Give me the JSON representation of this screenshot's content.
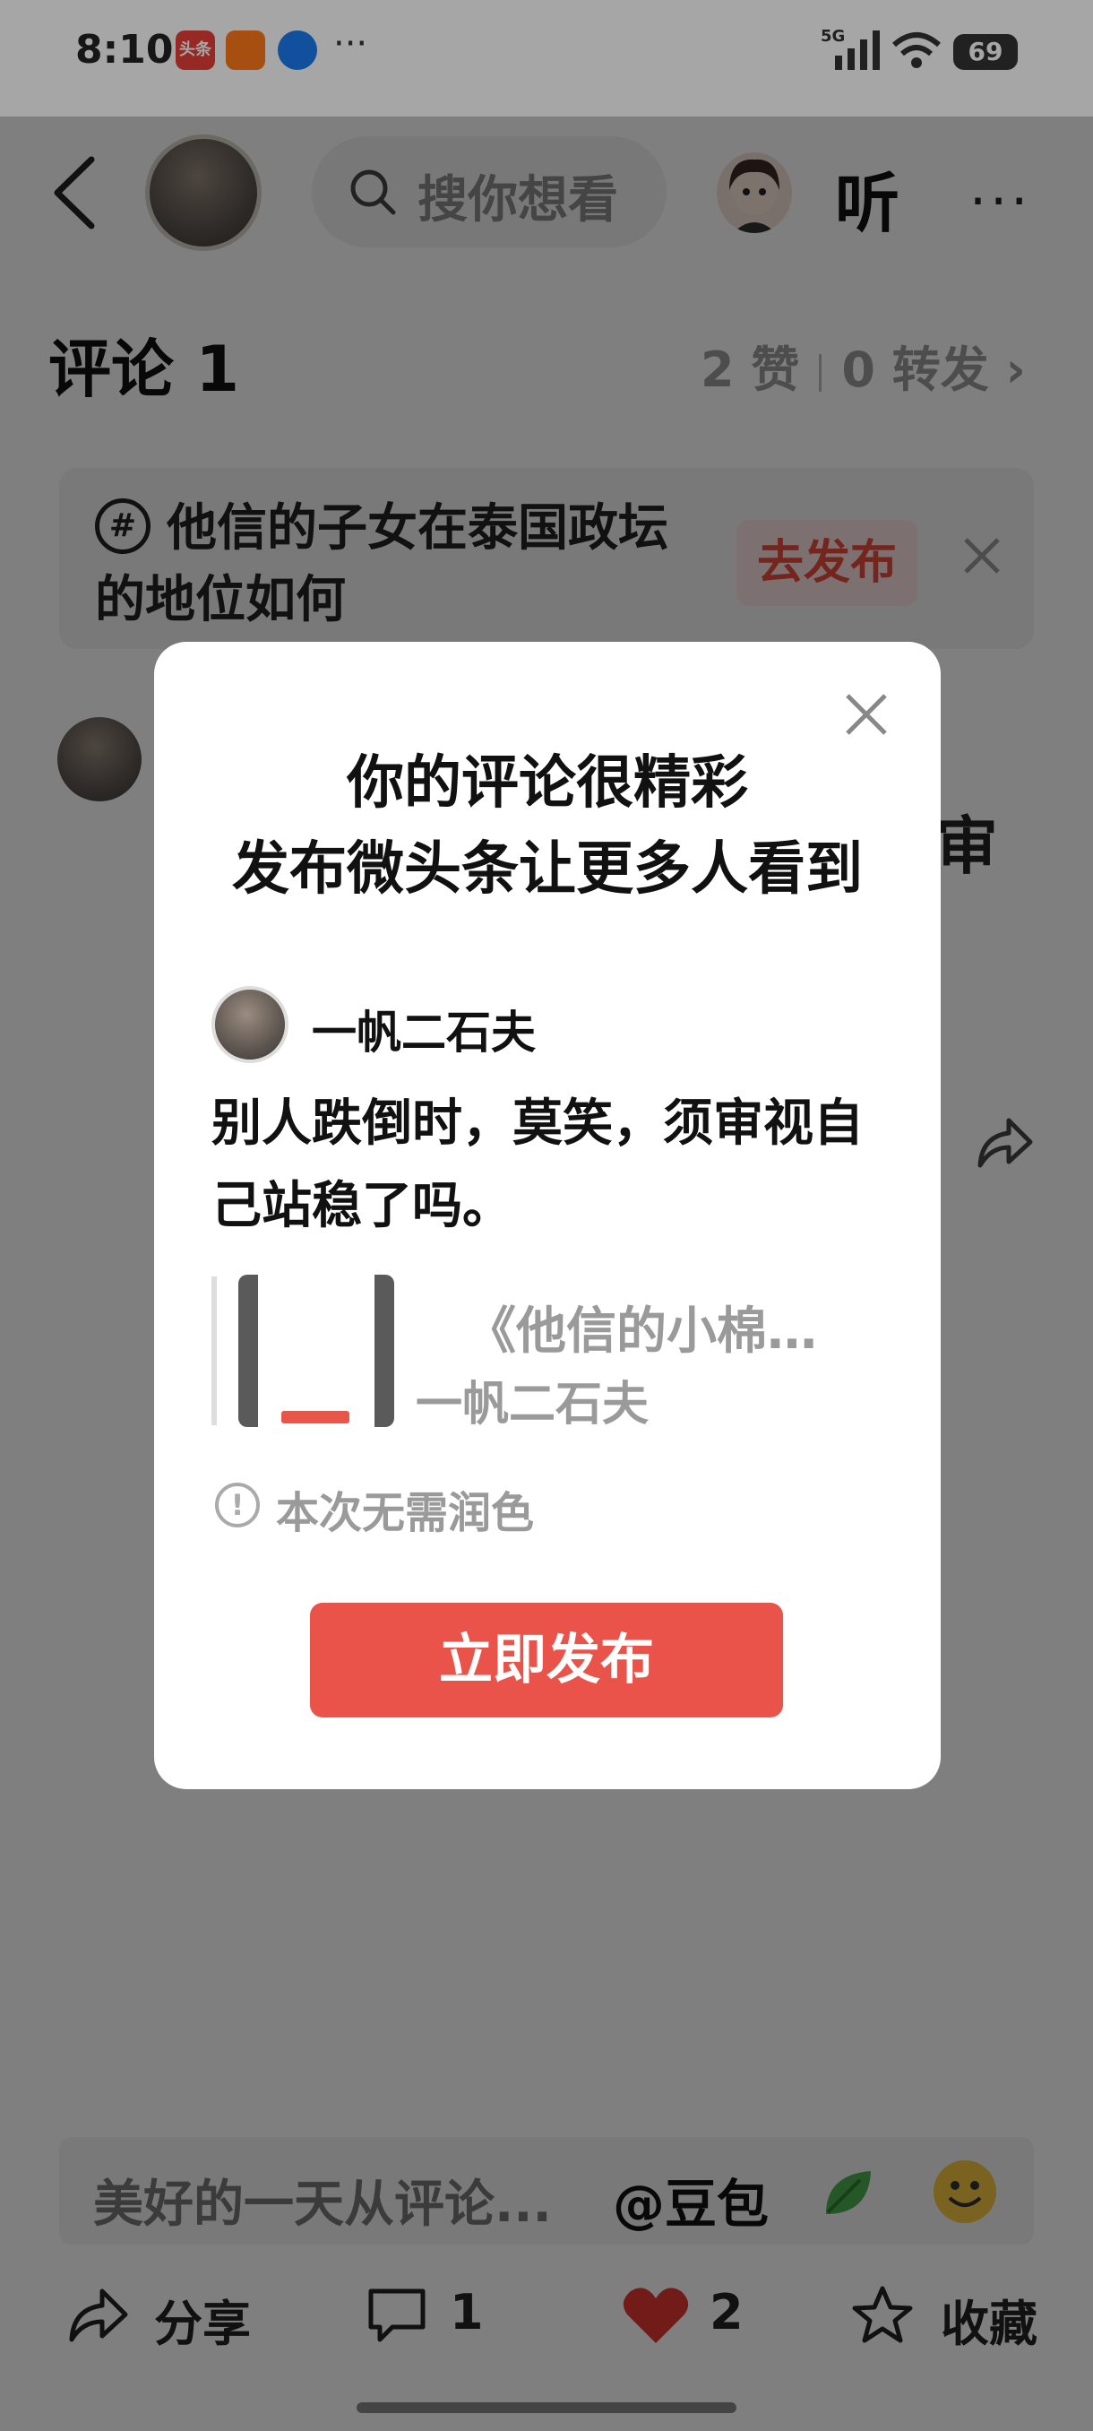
{
  "status_bar": {
    "time": "8:10",
    "toutiao_badge": "头条",
    "more": "···",
    "network": "5G",
    "battery": "69"
  },
  "header": {
    "search_placeholder": "搜你想看",
    "listen_label": "听",
    "more_label": "···"
  },
  "comments": {
    "title": "评论 1",
    "likes": "2 赞",
    "reposts": "0 转发",
    "chevron": "›",
    "overflow_char": "审"
  },
  "topic": {
    "hash_icon": "#",
    "text": "他信的子女在泰国政坛的地位如何",
    "publish_label": "去发布"
  },
  "modal": {
    "title_line1": "你的评论很精彩",
    "title_line2": "发布微头条让更多人看到",
    "author": "一帆二石夫",
    "text": "别人跌倒时，莫笑，须审视自己站稳了吗。",
    "quote_title": "《他信的小棉…",
    "quote_author": "一帆二石夫",
    "polish_icon": "!",
    "polish_note": "本次无需润色",
    "publish_label": "立即发布"
  },
  "bottom": {
    "input_placeholder": "美好的一天从评论...",
    "mention": "@豆包",
    "share_label": "分享",
    "comment_count": "1",
    "like_count": "2",
    "favorite_label": "收藏"
  }
}
